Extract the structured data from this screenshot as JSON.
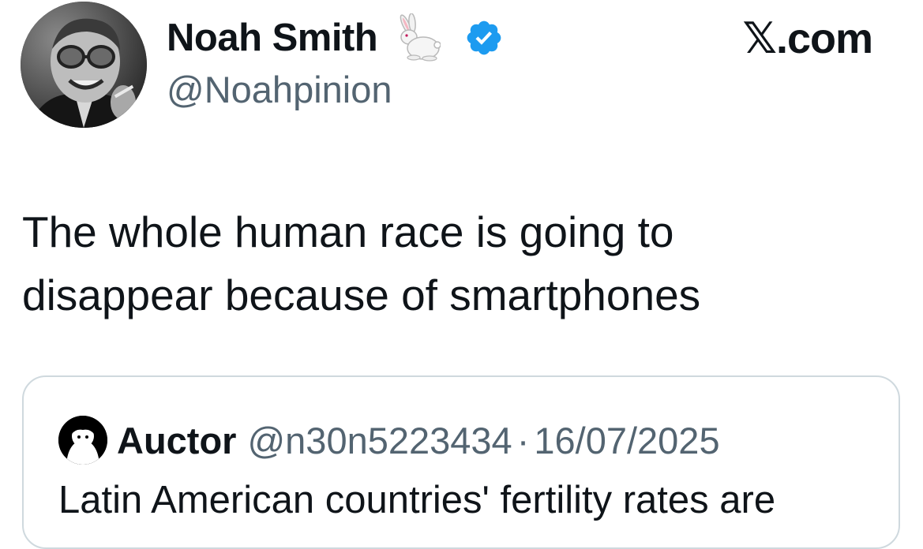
{
  "author": {
    "display_name": "Noah Smith",
    "name_emoji": "rabbit",
    "verified": true,
    "handle": "@Noahpinion"
  },
  "brand": "𝕏.com",
  "tweet": {
    "lines": [
      "The whole human race is going to",
      "disappear because of smartphones"
    ]
  },
  "quote": {
    "display_name": "Auctor",
    "handle": "@n30n5223434",
    "separator": "·",
    "date": "16/07/2025",
    "text": "Latin American countries' fertility rates are"
  },
  "colors": {
    "text": "#0f1419",
    "secondary": "#536471",
    "verified_blue": "#1d9bf0",
    "card_border": "#cfd9de"
  },
  "icons": {
    "name_emoji": "rabbit-icon",
    "verified": "verified-badge-icon"
  }
}
